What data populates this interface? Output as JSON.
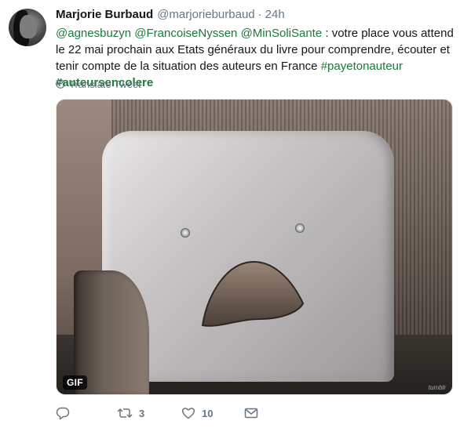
{
  "tweet": {
    "author_name": "Marjorie Burbaud",
    "author_handle": "@marjorieburbaud",
    "separator": "·",
    "time": "24h",
    "text": {
      "mention1": "@agnesbuzyn",
      "mention2": "@FrancoiseNyssen",
      "mention3": "@MinSoliSante",
      "body": " : votre place vous attend le 22 mai prochain aux Etats généraux du livre pour comprendre, écouter et tenir compte de la situation des auteurs en France ",
      "hashtag1": "#payetonauteur",
      "hashtag2": "#auteursencolere"
    },
    "translate_label": "Translate Tweet",
    "media": {
      "badge": "GIF",
      "watermark": "tumblr"
    },
    "actions": {
      "reply_icon": "reply-icon",
      "retweet_icon": "retweet-icon",
      "retweet_count": "3",
      "like_icon": "heart-icon",
      "like_count": "10",
      "dm_icon": "envelope-icon"
    }
  },
  "colors": {
    "link": "#1b7a3a",
    "muted": "#657786",
    "text": "#14171a"
  }
}
